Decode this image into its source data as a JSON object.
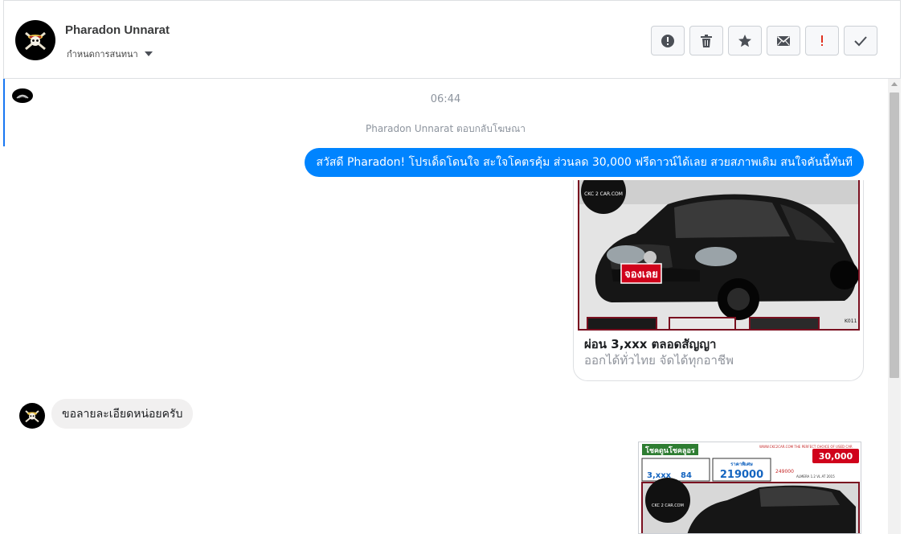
{
  "header": {
    "contact_name": "Pharadon Unnarat",
    "assign_label": "กำหนดการสนทนา",
    "actions": [
      {
        "name": "report-spam",
        "icon": "alert-circle-icon"
      },
      {
        "name": "delete",
        "icon": "trash-icon"
      },
      {
        "name": "star",
        "icon": "star-icon"
      },
      {
        "name": "mark-unread",
        "icon": "envelope-icon"
      },
      {
        "name": "mark-important",
        "icon": "exclamation-icon"
      },
      {
        "name": "mark-done",
        "icon": "check-icon"
      }
    ]
  },
  "thread": {
    "timestamp": "06:44",
    "event_text": "Pharadon Unnarat ตอบกลับโฆษณา",
    "outgoing_message": "สวัสดี Pharadon! โปรเด็ดโดนใจ สะใจโคตรคุ้ม ส่วนลด 30,000 ฟรีดาวน์ได้เลย สวยสภาพเดิม สนใจคันนี้ทันที",
    "ad_card": {
      "logo_text": "CKC 2 CAR.COM",
      "stamp_text": "จองเลย",
      "corner_code": "K011",
      "title": "ผ่อน 3,xxx ตลอดสัญญา",
      "subtitle": "ออกได้ทั่วไทย จัดได้ทุกอาชีพ"
    },
    "incoming_message": "ขอลายละเอียดหน่อยครับ",
    "promo_image": {
      "headline": "โชคดูนโชคลูอร",
      "site": "WWW.CKC2CAR.COM THE PERFECT CHOICE OF USED CAR",
      "discount": "30,000",
      "price_label": "ราคาพิเศษ",
      "price": "219000",
      "old_price": "249000",
      "installment": "3,xxx",
      "months": "84",
      "model": "ALMERA 1.2 VL AT 2015",
      "logo_text": "CKC 2 CAR.COM"
    }
  },
  "colors": {
    "accent": "#0084ff",
    "incoming_bubble": "#f1f0f0",
    "stamp_red": "#d0021b"
  }
}
